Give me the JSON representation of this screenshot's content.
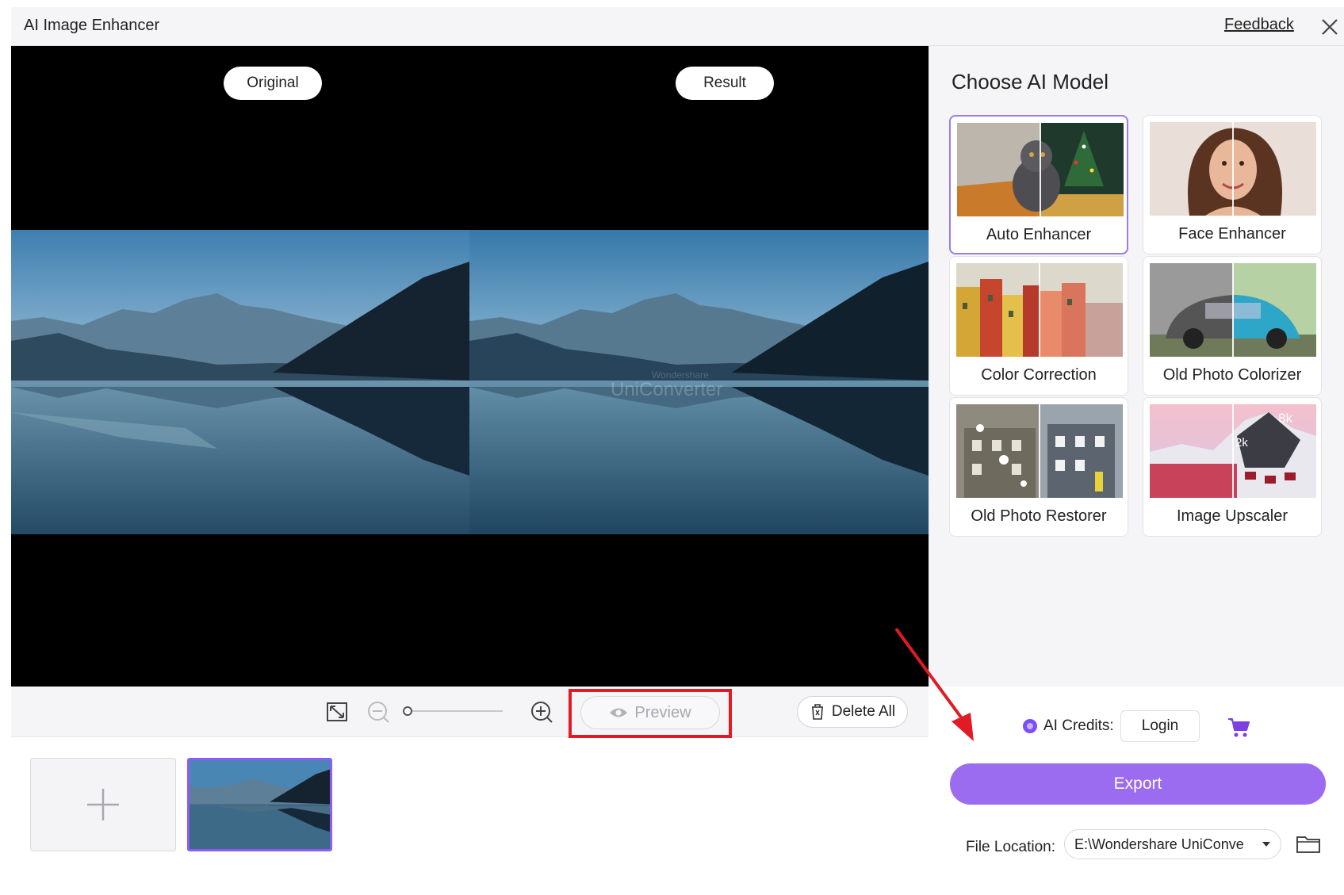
{
  "titlebar": {
    "title": "AI Image Enhancer",
    "feedback": "Feedback",
    "close_icon": "close-icon"
  },
  "preview": {
    "original_label": "Original",
    "result_label": "Result",
    "watermark_small": "Wondershare",
    "watermark": "UniConverter"
  },
  "toolbar": {
    "fit_icon": "fit-screen-icon",
    "zoom_out_icon": "zoom-out-icon",
    "zoom_in_icon": "zoom-in-icon",
    "zoom_level": 0,
    "preview_label": "Preview",
    "delete_all_label": "Delete All"
  },
  "panel": {
    "heading": "Choose AI Model",
    "models": [
      {
        "label": "Auto Enhancer",
        "selected": true
      },
      {
        "label": "Face Enhancer",
        "selected": false
      },
      {
        "label": "Color Correction",
        "selected": false
      },
      {
        "label": "Old Photo Colorizer",
        "selected": false
      },
      {
        "label": "Old Photo Restorer",
        "selected": false
      },
      {
        "label": "Image Upscaler",
        "selected": false,
        "badges": [
          "8k",
          "2k"
        ]
      }
    ]
  },
  "footer": {
    "credits_label": "AI Credits:",
    "login_label": "Login",
    "export_label": "Export",
    "file_location_label": "File Location:",
    "file_location_value": "E:\\Wondershare UniConve"
  },
  "colors": {
    "accent": "#9b6cf0",
    "highlight": "#e01b24",
    "selected_border": "#9a7bf0"
  }
}
